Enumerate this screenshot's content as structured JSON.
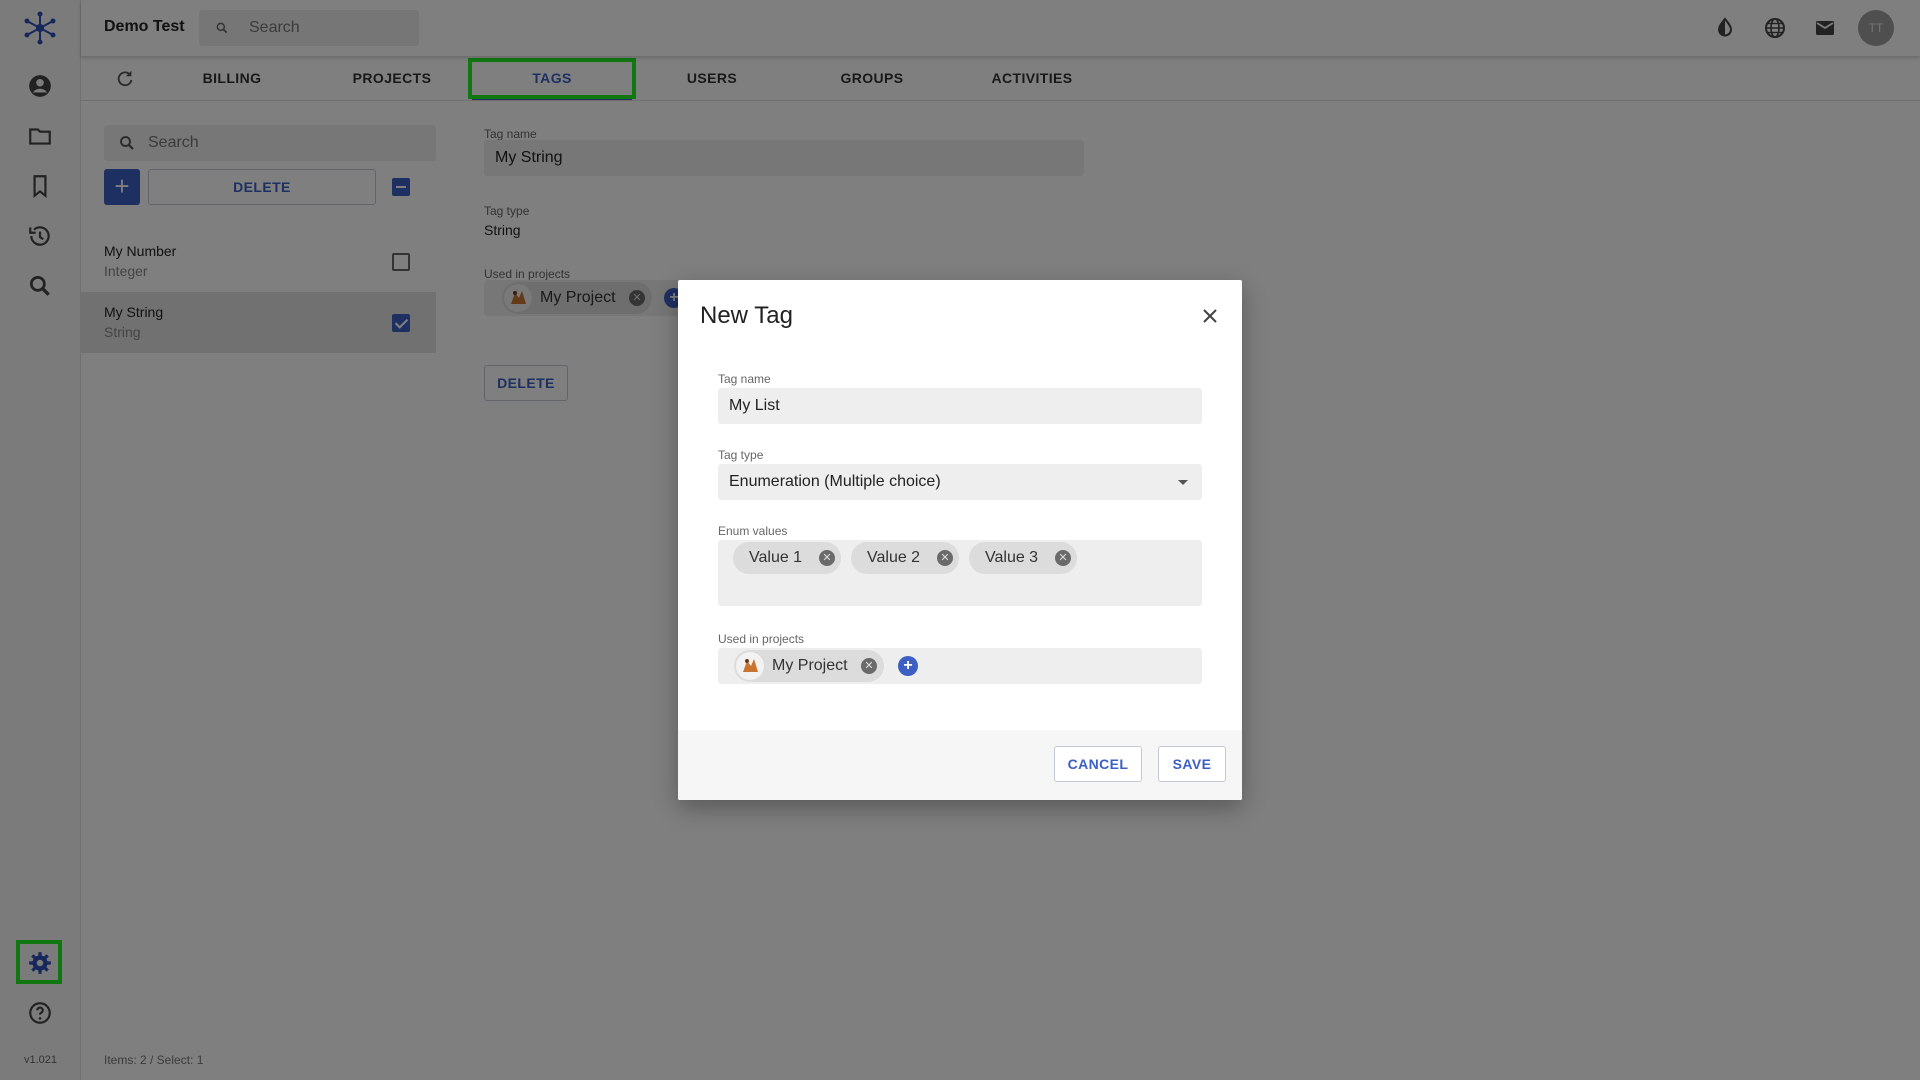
{
  "app": {
    "title": "Demo Test",
    "version": "v1.021"
  },
  "top_search": {
    "placeholder": "Search"
  },
  "user": {
    "initials": "TT"
  },
  "tabs": [
    {
      "label": "BILLING"
    },
    {
      "label": "PROJECTS"
    },
    {
      "label": "TAGS"
    },
    {
      "label": "USERS"
    },
    {
      "label": "GROUPS"
    },
    {
      "label": "ACTIVITIES"
    }
  ],
  "active_tab": "TAGS",
  "list_panel": {
    "search_placeholder": "Search",
    "delete_label": "DELETE",
    "items": [
      {
        "name": "My Number",
        "type": "Integer",
        "checked": false
      },
      {
        "name": "My String",
        "type": "String",
        "checked": true
      }
    ],
    "status": "Items: 2 / Select: 1"
  },
  "detail": {
    "tag_name_label": "Tag name",
    "tag_name_value": "My String",
    "tag_type_label": "Tag type",
    "tag_type_value": "String",
    "used_in_label": "Used in projects",
    "projects": [
      "My Project"
    ],
    "delete_label": "DELETE"
  },
  "dialog": {
    "title": "New Tag",
    "tag_name_label": "Tag name",
    "tag_name_value": "My List",
    "tag_type_label": "Tag type",
    "tag_type_value": "Enumeration (Multiple choice)",
    "enum_label": "Enum values",
    "enum_values": [
      "Value 1",
      "Value 2",
      "Value 3"
    ],
    "used_in_label": "Used in projects",
    "projects": [
      "My Project"
    ],
    "cancel_label": "CANCEL",
    "save_label": "SAVE"
  },
  "colors": {
    "accent": "#3d5fc4",
    "highlight": "#22ee22",
    "overlay": "rgba(0,0,0,0.5)"
  },
  "icons": [
    "app-logo-icon",
    "account-icon",
    "folder-icon",
    "bookmark-icon",
    "history-icon",
    "search-icon",
    "settings-icon",
    "help-icon",
    "contrast-icon",
    "globe-icon",
    "mail-icon",
    "refresh-icon",
    "close-icon"
  ]
}
